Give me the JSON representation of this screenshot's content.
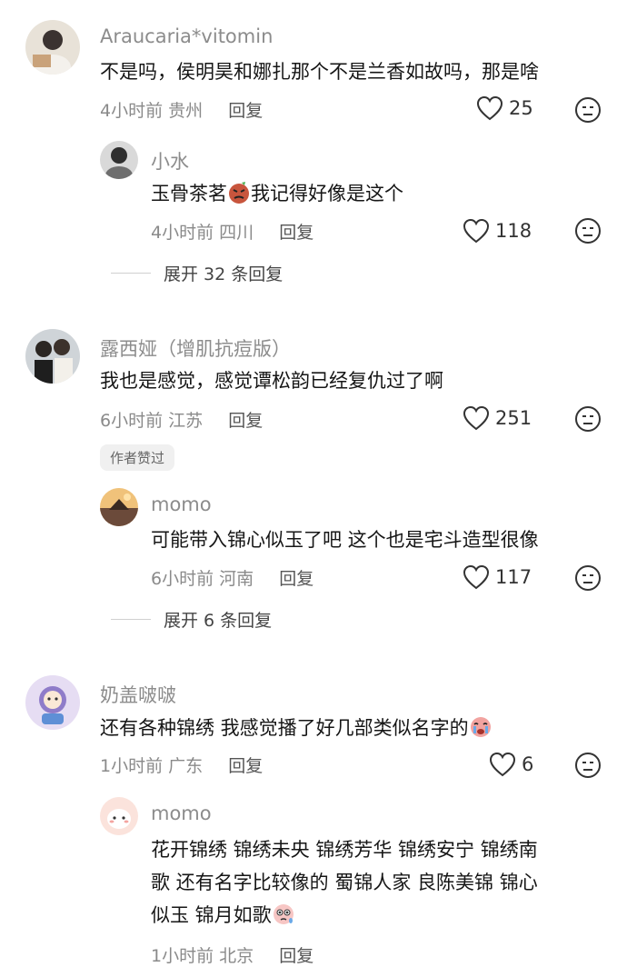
{
  "comments": [
    {
      "name": "Araucaria*vitomin",
      "text": "不是吗，侯明昊和娜扎那个不是兰香如故吗，那是啥",
      "time": "4小时前",
      "location": "贵州",
      "reply_label": "回复",
      "likes": "25"
    },
    {
      "name": "小水",
      "text_before": "玉骨茶茗",
      "text_after": "我记得好像是这个",
      "time": "4小时前",
      "location": "四川",
      "reply_label": "回复",
      "likes": "118",
      "expand_label": "展开 32 条回复"
    },
    {
      "name": "露西娅（增肌抗痘版）",
      "text": "我也是感觉，感觉谭松韵已经复仇过了啊",
      "time": "6小时前",
      "location": "江苏",
      "reply_label": "回复",
      "likes": "251",
      "badge": "作者赞过"
    },
    {
      "name": "momo",
      "text": "可能带入锦心似玉了吧 这个也是宅斗造型很像",
      "time": "6小时前",
      "location": "河南",
      "reply_label": "回复",
      "likes": "117",
      "expand_label": "展开 6 条回复"
    },
    {
      "name": "奶盖啵啵",
      "text": "还有各种锦绣 我感觉播了好几部类似名字的",
      "time": "1小时前",
      "location": "广东",
      "reply_label": "回复",
      "likes": "6"
    },
    {
      "name": "momo",
      "text_lines": [
        "花开锦绣 锦绣未央 锦绣芳华 锦绣安宁 锦绣南",
        "歌 还有名字比较像的 蜀锦人家 良陈美锦 锦心",
        "似玉 锦月如歌"
      ],
      "time": "1小时前",
      "location": "北京",
      "reply_label": "回复"
    }
  ],
  "icons": {
    "like": "heart-outline-icon",
    "dislike": "frown-face-icon",
    "emoji_angry": "angry-face-emoji",
    "emoji_cry": "crying-face-emoji",
    "emoji_pleading": "pleading-face-emoji"
  },
  "colors": {
    "name": "#8c8c8c",
    "meta": "#8a8a8a",
    "text": "#161616",
    "badge_bg": "#f0f0f0"
  }
}
